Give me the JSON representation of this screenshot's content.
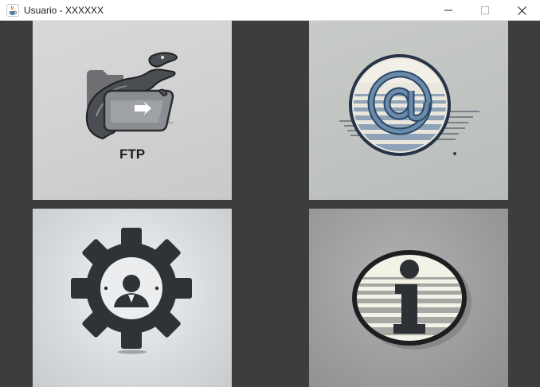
{
  "window": {
    "title": "Usuario - XXXXXX",
    "app_icon": "java-cup-icon",
    "controls": [
      "minimize-icon",
      "maximize-icon",
      "close-icon"
    ]
  },
  "content": {
    "background_color": "#3d3d3d",
    "tiles": [
      {
        "name": "ftp",
        "icon": "ftp-lizard-folder-icon",
        "label": "FTP"
      },
      {
        "name": "email",
        "icon": "at-sign-icon"
      },
      {
        "name": "user-settings",
        "icon": "gear-user-icon"
      },
      {
        "name": "info",
        "icon": "info-icon"
      }
    ]
  }
}
